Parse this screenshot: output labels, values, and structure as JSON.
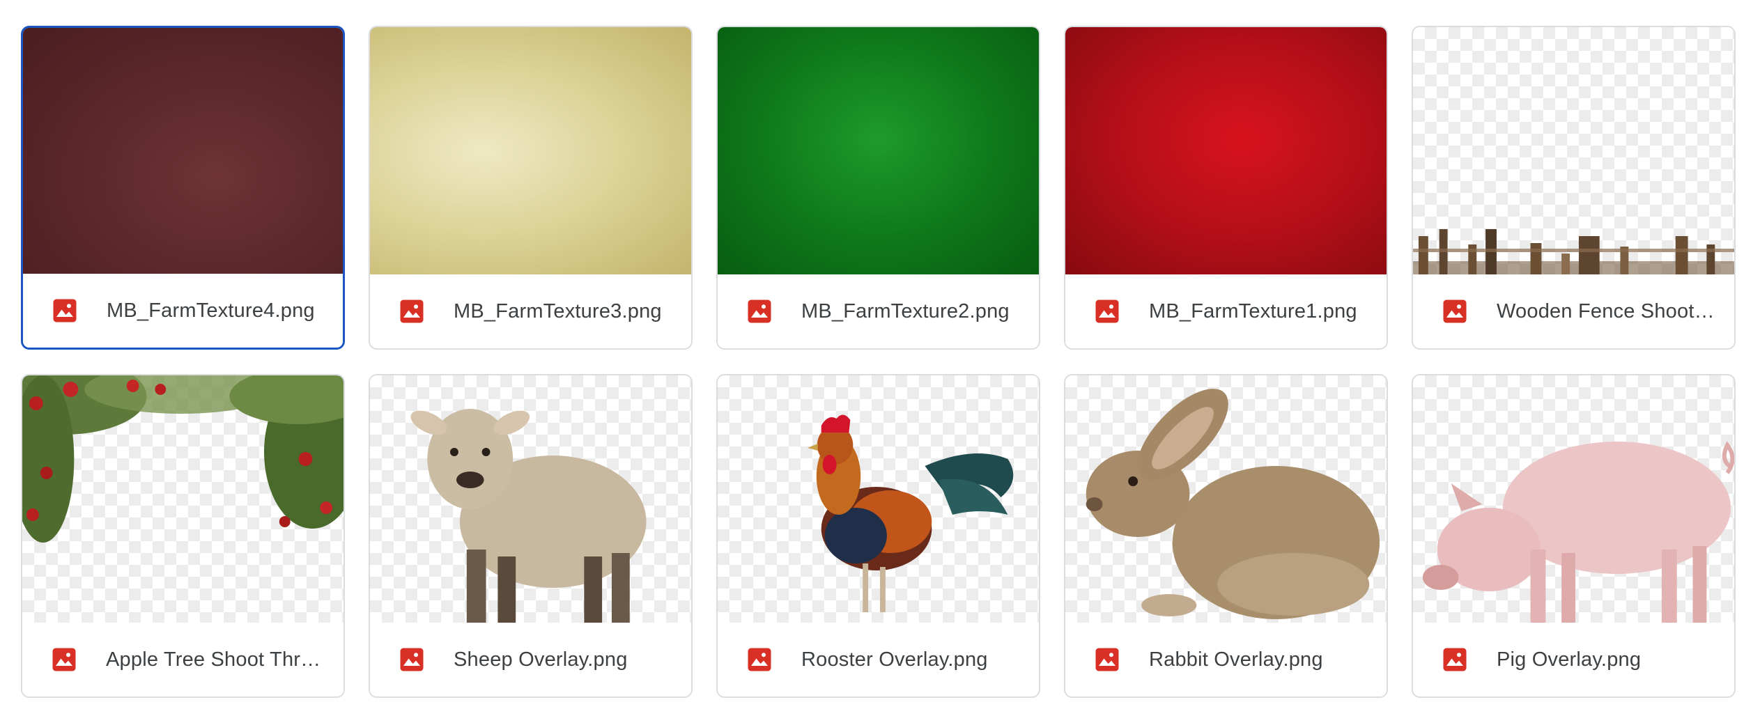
{
  "files": [
    {
      "name": "MB_FarmTexture4.png",
      "icon": "image-file-icon",
      "thumbnail": "dark maroon texture",
      "selected": true
    },
    {
      "name": "MB_FarmTexture3.png",
      "icon": "image-file-icon",
      "thumbnail": "pale yellow texture",
      "selected": false
    },
    {
      "name": "MB_FarmTexture2.png",
      "icon": "image-file-icon",
      "thumbnail": "green texture",
      "selected": false
    },
    {
      "name": "MB_FarmTexture1.png",
      "icon": "image-file-icon",
      "thumbnail": "red texture",
      "selected": false
    },
    {
      "name": "Wooden Fence Shoot …",
      "icon": "image-file-icon",
      "thumbnail": "wooden fence overlay",
      "selected": false
    },
    {
      "name": "Apple Tree Shoot Thro…",
      "icon": "image-file-icon",
      "thumbnail": "apple tree branches overlay",
      "selected": false
    },
    {
      "name": "Sheep Overlay.png",
      "icon": "image-file-icon",
      "thumbnail": "sheep",
      "selected": false
    },
    {
      "name": "Rooster Overlay.png",
      "icon": "image-file-icon",
      "thumbnail": "rooster",
      "selected": false
    },
    {
      "name": "Rabbit Overlay.png",
      "icon": "image-file-icon",
      "thumbnail": "rabbit",
      "selected": false
    },
    {
      "name": "Pig Overlay.png",
      "icon": "image-file-icon",
      "thumbnail": "pig",
      "selected": false
    }
  ],
  "colors": {
    "selected_border": "#1a56c2",
    "card_border": "#dadce0",
    "file_icon": "#d93025",
    "file_name_text": "#3c4043"
  }
}
